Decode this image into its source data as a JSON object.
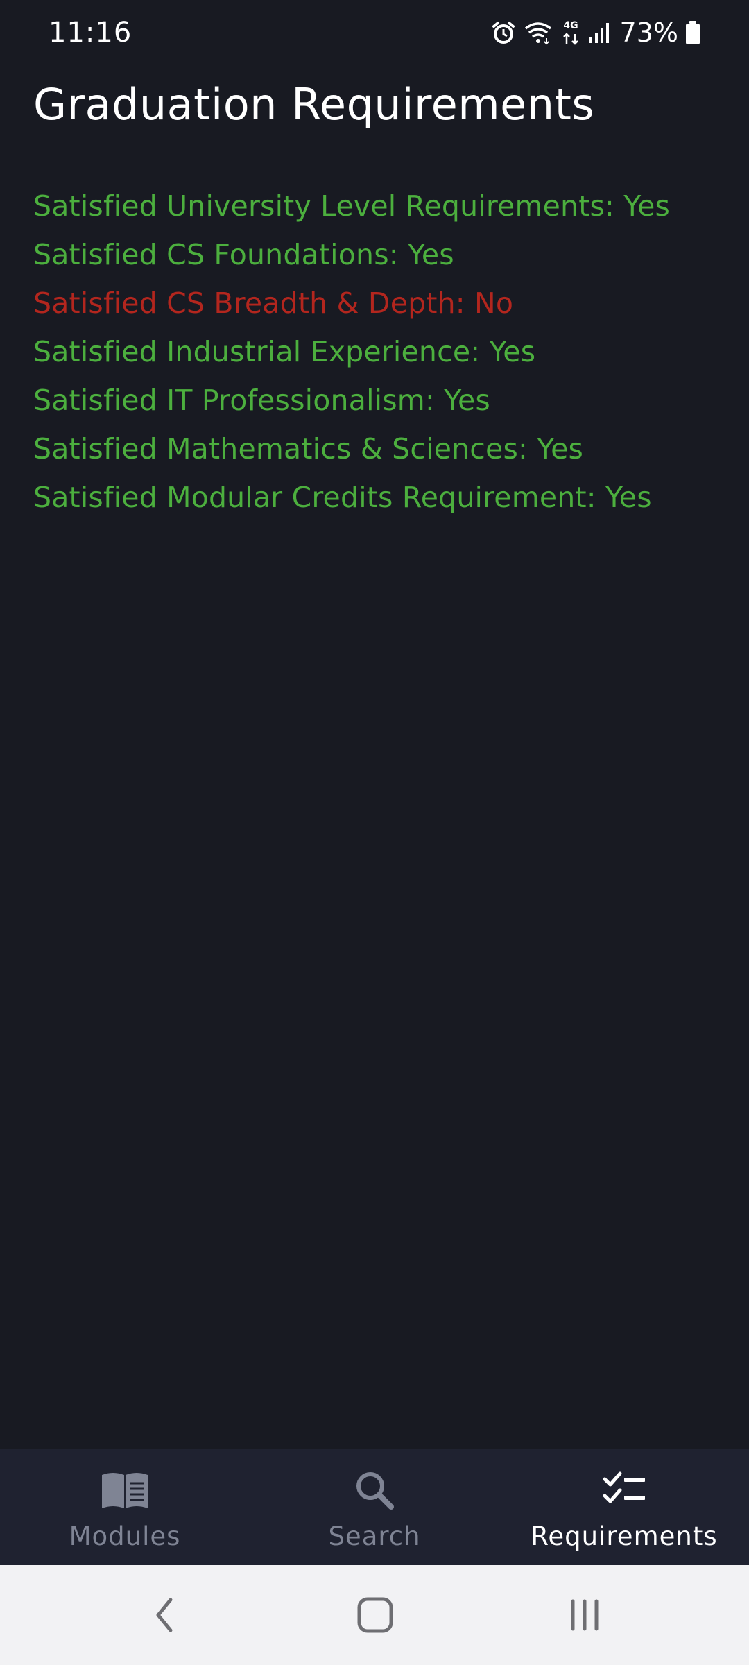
{
  "status_bar": {
    "time": "11:16",
    "battery_percent": "73%",
    "network_label": "4G",
    "icons": [
      "alarm-icon",
      "wifi-icon",
      "mobile-data-icon",
      "signal-icon",
      "battery-icon"
    ]
  },
  "header": {
    "title": "Graduation Requirements"
  },
  "requirements": [
    {
      "text": "Satisfied University Level Requirements: Yes",
      "status": "Yes",
      "color": "#4caf3e"
    },
    {
      "text": "Satisfied CS Foundations: Yes",
      "status": "Yes",
      "color": "#4caf3e"
    },
    {
      "text": "Satisfied CS Breadth & Depth: No",
      "status": "No",
      "color": "#b3261e"
    },
    {
      "text": "Satisfied Industrial Experience: Yes",
      "status": "Yes",
      "color": "#4caf3e"
    },
    {
      "text": "Satisfied IT Professionalism: Yes",
      "status": "Yes",
      "color": "#4caf3e"
    },
    {
      "text": "Satisfied Mathematics & Sciences: Yes",
      "status": "Yes",
      "color": "#4caf3e"
    },
    {
      "text": "Satisfied Modular Credits Requirement: Yes",
      "status": "Yes",
      "color": "#4caf3e"
    }
  ],
  "bottom_nav": {
    "items": [
      {
        "label": "Modules",
        "icon": "book-icon",
        "active": false
      },
      {
        "label": "Search",
        "icon": "search-icon",
        "active": false
      },
      {
        "label": "Requirements",
        "icon": "checklist-icon",
        "active": true
      }
    ]
  },
  "system_nav": {
    "buttons": [
      "back-icon",
      "home-icon",
      "recents-icon"
    ]
  },
  "colors": {
    "background": "#181a22",
    "nav_background": "#1f2230",
    "satisfied": "#4caf3e",
    "unsatisfied": "#b3261e",
    "inactive_nav": "#7f8494",
    "active_nav": "#ffffff"
  }
}
